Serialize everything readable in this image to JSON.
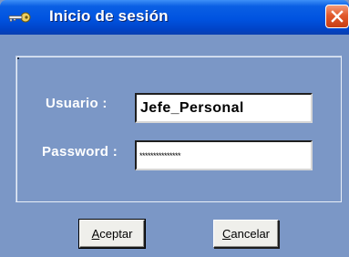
{
  "window": {
    "title": "Inicio de sesión",
    "icon": "key-icon",
    "close_icon": "close-icon",
    "close_color": "#e25a2c",
    "titlebar_color": "#0053e0",
    "background_color": "#7b97c6"
  },
  "form": {
    "user_label": "Usuario :",
    "user_value": "Jefe_Personal",
    "password_label": "Password :",
    "password_value": "***************"
  },
  "buttons": {
    "accept_accel": "A",
    "accept_rest": "ceptar",
    "cancel_accel": "C",
    "cancel_rest": "ancelar"
  }
}
